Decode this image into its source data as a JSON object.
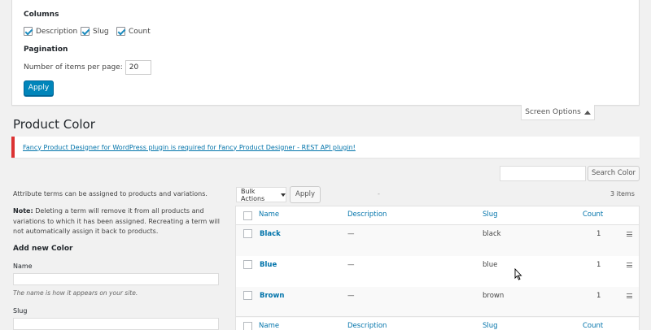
{
  "screen_options": {
    "columns_heading": "Columns",
    "columns": [
      {
        "label": "Description",
        "checked": true
      },
      {
        "label": "Slug",
        "checked": true
      },
      {
        "label": "Count",
        "checked": true
      }
    ],
    "pagination_heading": "Pagination",
    "per_page_label": "Number of items per page:",
    "per_page_value": "20",
    "apply_label": "Apply",
    "tab_label": "Screen Options"
  },
  "page_title": "Product Color",
  "notice": {
    "text": "Fancy Product Designer for WordPress plugin is required for Fancy Product Designer - REST API plugin!",
    "color": "#dc3232"
  },
  "search": {
    "value": "",
    "button_label": "Search Color"
  },
  "left": {
    "intro": "Attribute terms can be assigned to products and variations.",
    "note_label": "Note:",
    "note_text": "Deleting a term will remove it from all products and variations to which it has been assigned. Recreating a term will not automatically assign it back to products.",
    "add_heading": "Add new Color",
    "name_label": "Name",
    "name_desc": "The name is how it appears on your site.",
    "slug_label": "Slug"
  },
  "tablenav": {
    "bulk_label": "Bulk Actions",
    "apply_label": "Apply",
    "dash": "-",
    "items_count": "3 items"
  },
  "table": {
    "headers": {
      "name": "Name",
      "description": "Description",
      "slug": "Slug",
      "count": "Count"
    },
    "rows": [
      {
        "name": "Black",
        "description": "—",
        "slug": "black",
        "count": "1"
      },
      {
        "name": "Blue",
        "description": "—",
        "slug": "blue",
        "count": "1"
      },
      {
        "name": "Brown",
        "description": "—",
        "slug": "brown",
        "count": "1"
      }
    ]
  },
  "colors": {
    "primary": "#0085ba",
    "link": "#0073aa",
    "notice_error": "#dc3232"
  }
}
